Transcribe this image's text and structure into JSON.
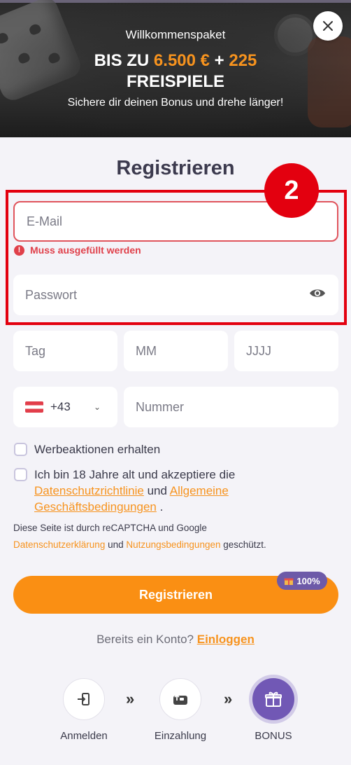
{
  "banner": {
    "subtitle": "Willkommenspaket",
    "title_prefix": "BIS ZU ",
    "title_amount": "6.500 €",
    "title_plus": " + ",
    "title_spins": "225",
    "title_line2": "FREISPIELE",
    "tagline": "Sichere dir deinen Bonus und drehe länger!"
  },
  "form": {
    "title": "Registrieren",
    "annotation_number": "2",
    "email_placeholder": "E-Mail",
    "email_error": "Muss ausgefüllt werden",
    "password_placeholder": "Passwort",
    "day_placeholder": "Tag",
    "month_placeholder": "MM",
    "year_placeholder": "JJJJ",
    "phone_code": "+43",
    "phone_placeholder": "Nummer",
    "promo_label": "Werbeaktionen erhalten",
    "terms_text_1": "Ich bin 18 Jahre alt und akzeptiere die",
    "terms_link_privacy": "Datenschutzrichtlinie",
    "terms_and": " und ",
    "terms_link_general": "Allgemeine",
    "terms_link_general_2": "Geschäftsbedingungen",
    "terms_end": " .",
    "recaptcha_text_1": "Diese Seite ist durch reCAPTCHA und Google",
    "recaptcha_link_privacy": "Datenschutzerklärung",
    "recaptcha_and": " und ",
    "recaptcha_link_terms": "Nutzungsbedingungen",
    "recaptcha_end": " geschützt.",
    "register_button": "Registrieren",
    "bonus_badge": "100%",
    "have_account": "Bereits ein Konto? ",
    "login_link": "Einloggen"
  },
  "steps": [
    {
      "label": "Anmelden",
      "icon": "login-icon"
    },
    {
      "label": "Einzahlung",
      "icon": "deposit-icon"
    },
    {
      "label": "BONUS",
      "icon": "gift-icon"
    }
  ],
  "colors": {
    "accent": "#fa8f13",
    "error": "#e0404a",
    "annotation": "#e3000f",
    "purple": "#7158b5"
  }
}
